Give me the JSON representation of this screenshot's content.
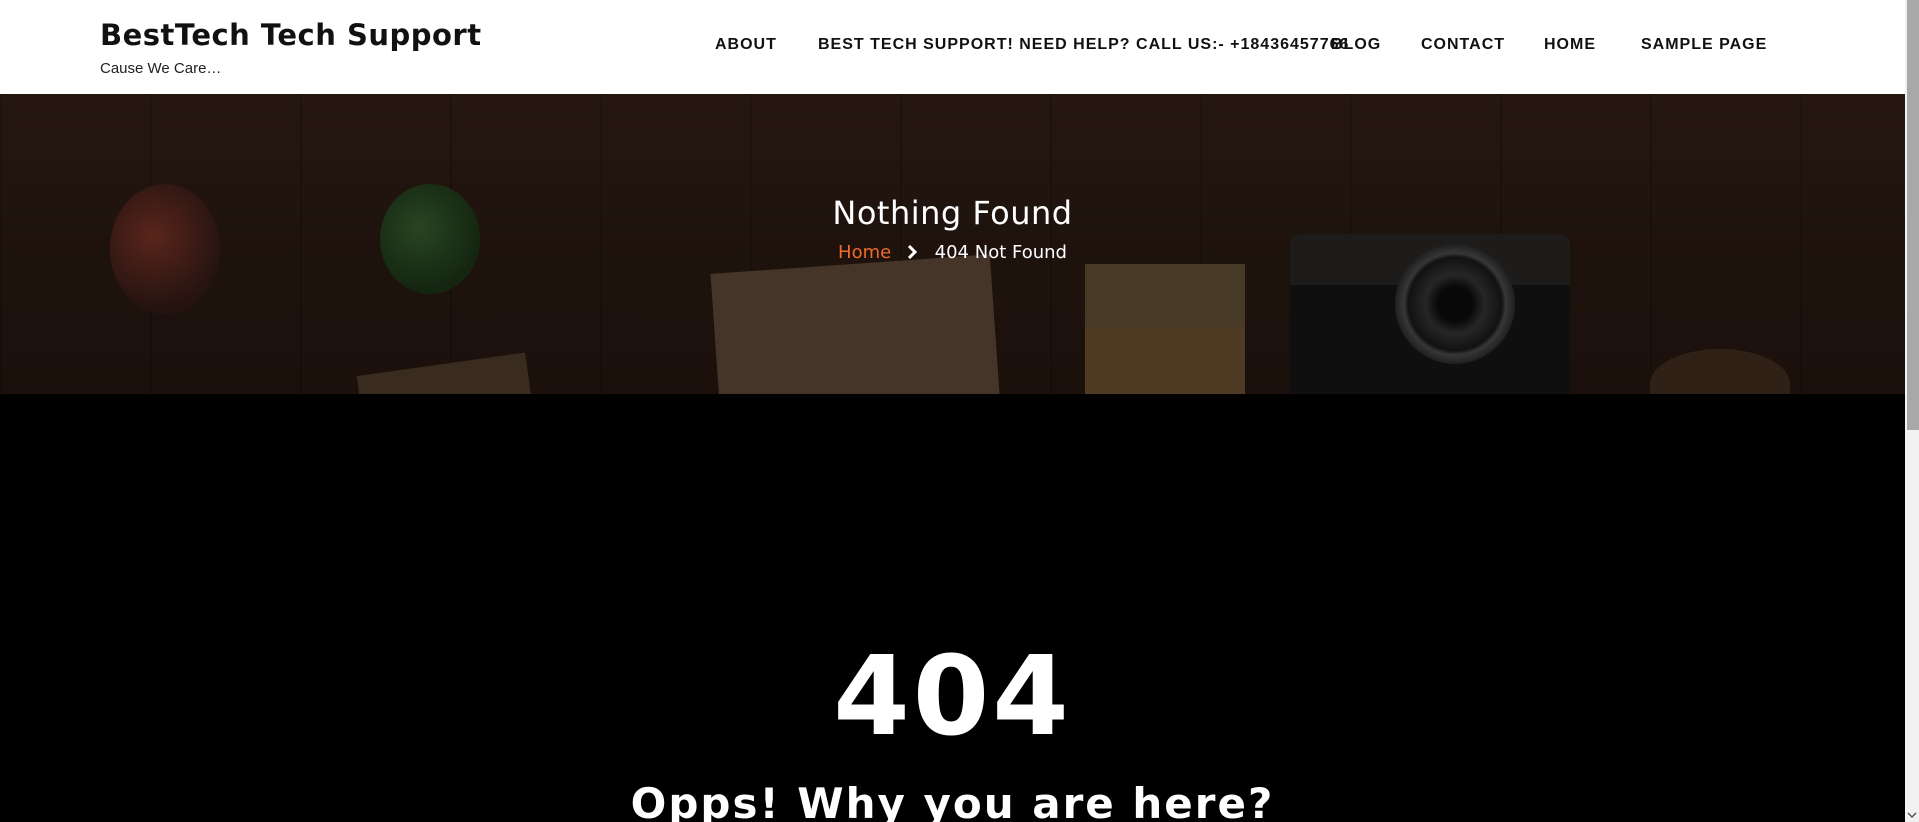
{
  "header": {
    "site_title": "BestTech Tech Support",
    "tagline": "Cause We Care…",
    "nav": [
      {
        "label": "ABOUT"
      },
      {
        "label": "BEST TECH SUPPORT! NEED HELP? CALL US:- +18436457766"
      },
      {
        "label": "BLOG"
      },
      {
        "label": "CONTACT"
      },
      {
        "label": "HOME"
      },
      {
        "label": "SAMPLE PAGE"
      }
    ]
  },
  "hero": {
    "title": "Nothing Found",
    "breadcrumb": {
      "home": "Home",
      "current": "404 Not Found"
    },
    "colors": {
      "crumb_link": "#f06b2c"
    }
  },
  "error": {
    "code": "404",
    "message": "Opps! Why you are here?"
  },
  "icons": {
    "breadcrumb_separator": "chevron-right-icon",
    "scroll_down": "chevron-down-icon"
  }
}
